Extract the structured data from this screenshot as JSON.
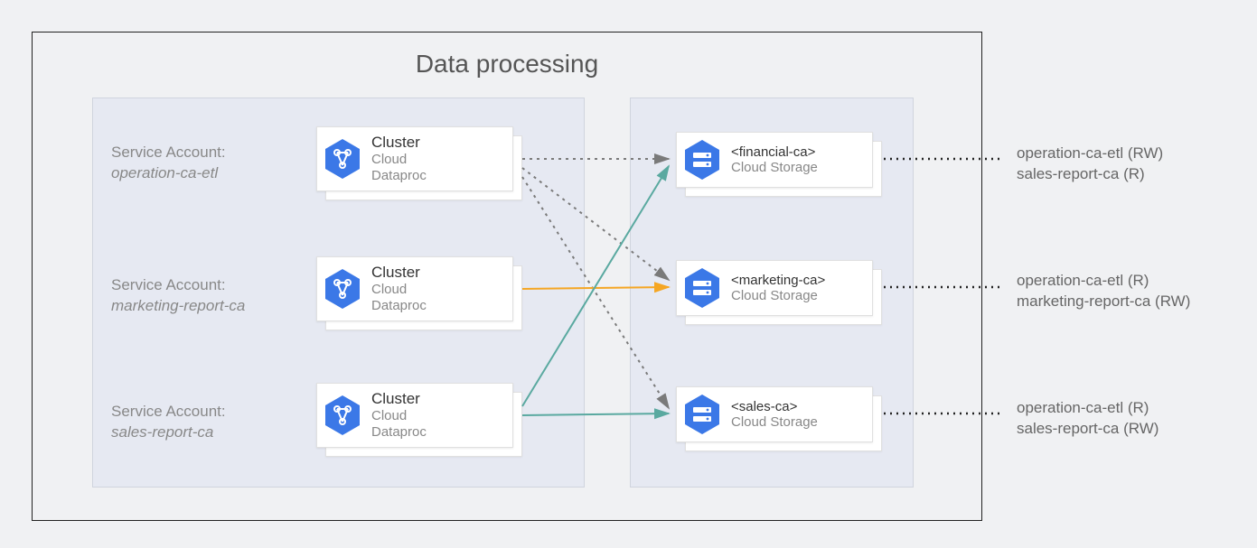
{
  "title": "Data processing",
  "service_accounts": [
    {
      "label": "Service Account:",
      "name": "operation-ca-etl"
    },
    {
      "label": "Service Account:",
      "name": "marketing-report-ca"
    },
    {
      "label": "Service Account:",
      "name": "sales-report-ca"
    }
  ],
  "clusters": [
    {
      "title": "Cluster",
      "subtitle1": "Cloud",
      "subtitle2": "Dataproc"
    },
    {
      "title": "Cluster",
      "subtitle1": "Cloud",
      "subtitle2": "Dataproc"
    },
    {
      "title": "Cluster",
      "subtitle1": "Cloud",
      "subtitle2": "Dataproc"
    }
  ],
  "storages": [
    {
      "title": "<financial-ca>",
      "subtitle": "Cloud Storage"
    },
    {
      "title": "<marketing-ca>",
      "subtitle": "Cloud Storage"
    },
    {
      "title": "<sales-ca>",
      "subtitle": "Cloud Storage"
    }
  ],
  "perms": [
    {
      "line1": "operation-ca-etl (RW)",
      "line2": "sales-report-ca (R)"
    },
    {
      "line1": "operation-ca-etl (R)",
      "line2": "marketing-report-ca (RW)"
    },
    {
      "line1": "operation-ca-etl (R)",
      "line2": "sales-report-ca (RW)"
    }
  ]
}
